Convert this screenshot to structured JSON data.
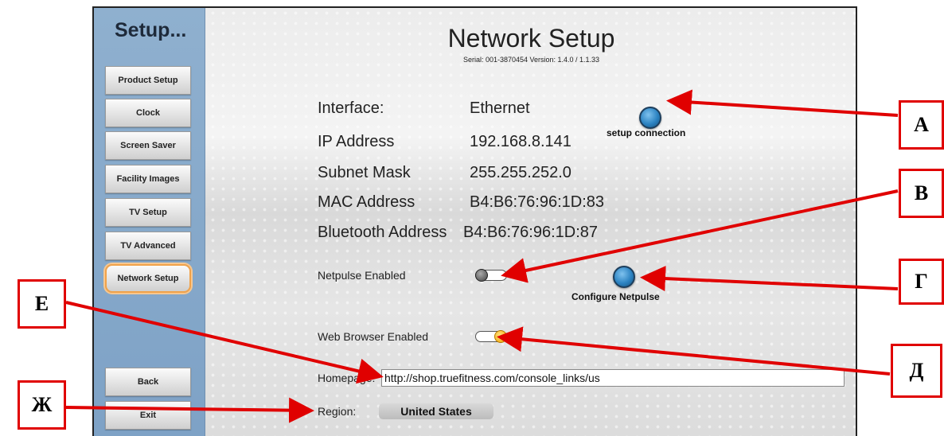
{
  "sidebar": {
    "title": "Setup...",
    "items": [
      {
        "label": "Product Setup"
      },
      {
        "label": "Clock"
      },
      {
        "label": "Screen Saver"
      },
      {
        "label": "Facility Images"
      },
      {
        "label": "TV Setup"
      },
      {
        "label": "TV Advanced"
      },
      {
        "label": "Network Setup",
        "active": true
      }
    ],
    "back_label": "Back",
    "exit_label": "Exit"
  },
  "header": {
    "title": "Network Setup",
    "serial": "Serial: 001-3870454   Version: 1.4.0 / 1.1.33"
  },
  "info": [
    {
      "label": "Interface:",
      "value": "Ethernet"
    },
    {
      "label": "IP Address",
      "value": "192.168.8.141"
    },
    {
      "label": "Subnet Mask",
      "value": "255.255.252.0"
    },
    {
      "label": "MAC Address",
      "value": "B4:B6:76:96:1D:83"
    },
    {
      "label": "Bluetooth Address",
      "value": "B4:B6:76:96:1D:87"
    }
  ],
  "setup_connection_label": "setup connection",
  "netpulse": {
    "label": "Netpulse Enabled",
    "enabled": false
  },
  "configure_netpulse_label": "Configure Netpulse",
  "web_browser": {
    "label": "Web Browser Enabled",
    "enabled": true
  },
  "homepage": {
    "label": "Homepage:",
    "value": "http://shop.truefitness.com/console_links/us"
  },
  "region": {
    "label": "Region:",
    "value": "United States"
  },
  "callouts": {
    "a": "А",
    "b": "В",
    "g": "Г",
    "d": "Д",
    "e": "Е",
    "zh": "Ж"
  },
  "colors": {
    "sidebar": "#8fb0cf",
    "active_border": "#f0a24a",
    "annotation_red": "#e00000",
    "orb_blue": "#2c83c2"
  }
}
